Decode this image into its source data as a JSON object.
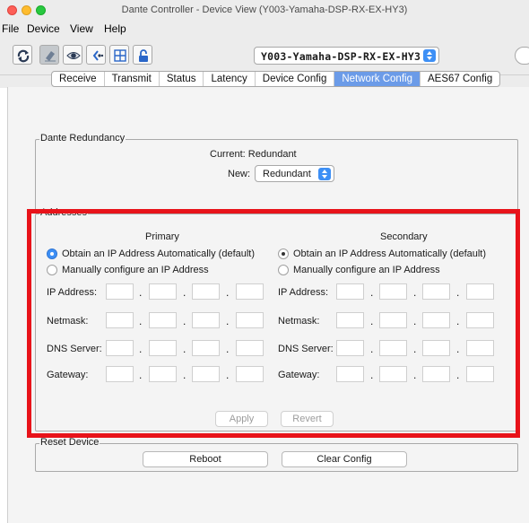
{
  "window": {
    "title": "Dante Controller - Device View (Y003-Yamaha-DSP-RX-EX-HY3)"
  },
  "menu": [
    "File",
    "Device",
    "View",
    "Help"
  ],
  "toolbar": {
    "device_name": "Y003-Yamaha-DSP-RX-EX-HY3",
    "buttons": [
      "refresh-icon",
      "eraser-icon",
      "eye-icon",
      "connect-icon",
      "grid-icon",
      "lock-icon"
    ]
  },
  "tabs": [
    {
      "label": "Receive",
      "active": false
    },
    {
      "label": "Transmit",
      "active": false
    },
    {
      "label": "Status",
      "active": false
    },
    {
      "label": "Latency",
      "active": false
    },
    {
      "label": "Device Config",
      "active": false
    },
    {
      "label": "Network Config",
      "active": true
    },
    {
      "label": "AES67 Config",
      "active": false
    }
  ],
  "redundancy": {
    "legend": "Dante Redundancy",
    "current_label": "Current: Redundant",
    "new_label": "New:",
    "new_value": "Redundant"
  },
  "addresses": {
    "legend": "Addresses",
    "primary": {
      "heading": "Primary",
      "option_auto": "Obtain an IP Address Automatically (default)",
      "option_manual": "Manually configure an IP Address",
      "selected": "auto"
    },
    "secondary": {
      "heading": "Secondary",
      "option_auto": "Obtain an IP Address Automatically (default)",
      "option_manual": "Manually configure an IP Address",
      "selected": "auto"
    },
    "field_labels": {
      "ip": "IP Address:",
      "netmask": "Netmask:",
      "dns": "DNS Server:",
      "gateway": "Gateway:"
    },
    "apply_label": "Apply",
    "revert_label": "Revert"
  },
  "reset": {
    "legend": "Reset Device",
    "reboot_label": "Reboot",
    "clear_label": "Clear Config"
  },
  "colors": {
    "highlight": "#e8131a",
    "accent": "#3d8ff5",
    "active_tab": "#6b9be8"
  }
}
